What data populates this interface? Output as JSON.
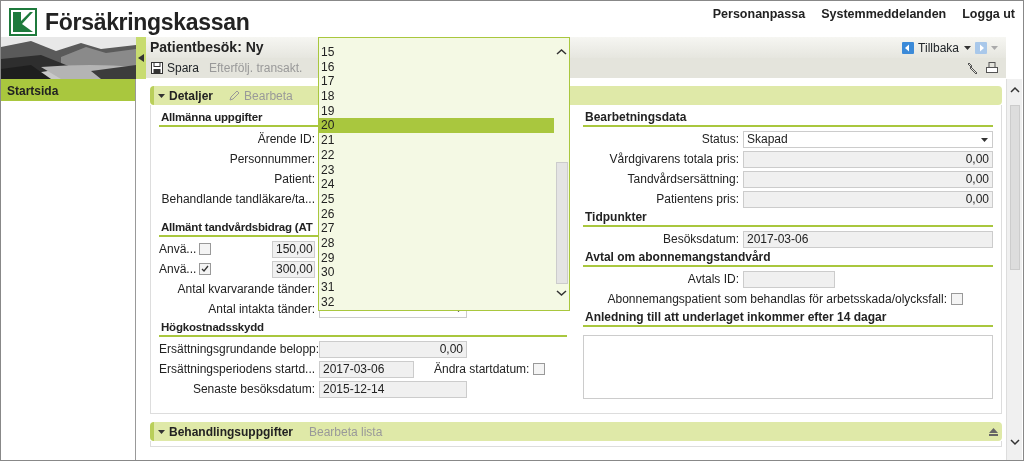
{
  "header": {
    "logo_text": "Försäkringskassan",
    "links": [
      "Personanpassa",
      "Systemmeddelanden",
      "Logga ut"
    ]
  },
  "sidebar": {
    "items": [
      {
        "label": "Startsida",
        "selected": true
      }
    ]
  },
  "page": {
    "title": "Patientbesök: Ny",
    "back_button": "Tillbaka"
  },
  "toolbar": [
    {
      "label": "Spara",
      "disabled": false
    },
    {
      "label": "Efterfölj. transakt.",
      "disabled": true
    }
  ],
  "details": {
    "title": "Detaljer",
    "action": {
      "label": "Bearbeta",
      "disabled": true
    },
    "left": [
      {
        "title": "Allmänna uppgifter",
        "rows": [
          {
            "kind": "label",
            "label": "Ärende ID:"
          },
          {
            "kind": "label",
            "label": "Personnummer:"
          },
          {
            "kind": "label",
            "label": "Patient:"
          },
          {
            "kind": "label",
            "label": "Behandlande tandläkare/ta..."
          }
        ]
      },
      {
        "title": "Allmänt tandvårdsbidrag (AT",
        "rows": [
          {
            "kind": "check_amount",
            "label": "Anvä...",
            "checked": false,
            "value": "150,00"
          },
          {
            "kind": "check_amount",
            "label": "Anvä...",
            "checked": true,
            "value": "300,00"
          },
          {
            "kind": "label",
            "label": "Antal kvarvarande tänder:"
          },
          {
            "kind": "select",
            "label": "Antal intakta tänder:"
          }
        ]
      },
      {
        "title": "Högkostnadsskydd",
        "rows": [
          {
            "kind": "amount",
            "label": "Ersättningsgrundande belopp:",
            "value": "0,00"
          },
          {
            "kind": "date_check",
            "label": "Ersättningsperiodens startd...",
            "value": "2017-03-06",
            "check_label": "Ändra startdatum:",
            "checked": false
          },
          {
            "kind": "date",
            "label": "Senaste besöksdatum:",
            "value": "2015-12-14"
          }
        ]
      }
    ],
    "right": [
      {
        "title": "Bearbetningsdata",
        "rows": [
          {
            "kind": "select",
            "label": "Status:",
            "value": "Skapad"
          },
          {
            "kind": "amount",
            "label": "Vårdgivarens totala pris:",
            "value": "0,00"
          },
          {
            "kind": "amount",
            "label": "Tandvårdsersättning:",
            "value": "0,00"
          },
          {
            "kind": "amount",
            "label": "Patientens pris:",
            "value": "0,00"
          }
        ]
      },
      {
        "title": "Tidpunkter",
        "rows": [
          {
            "kind": "date",
            "label": "Besöksdatum:",
            "value": "2017-03-06"
          }
        ]
      },
      {
        "title": "Avtal om abonnemangstandvård",
        "rows": [
          {
            "kind": "short",
            "label": "Avtals ID:"
          },
          {
            "kind": "checkbox",
            "label": "Abonnemangspatient som behandlas för arbetsskada/olycksfall:",
            "checked": false
          }
        ]
      },
      {
        "title": "Anledning till att underlaget inkommer efter 14 dagar",
        "rows": [
          {
            "kind": "textarea"
          }
        ]
      }
    ]
  },
  "dropdown": {
    "options": [
      {
        "label": "15",
        "selected": false
      },
      {
        "label": "16",
        "selected": false
      },
      {
        "label": "17",
        "selected": false
      },
      {
        "label": "18",
        "selected": false
      },
      {
        "label": "19",
        "selected": false
      },
      {
        "label": "20",
        "selected": true
      },
      {
        "label": "21",
        "selected": false
      },
      {
        "label": "22",
        "selected": false
      },
      {
        "label": "23",
        "selected": false
      },
      {
        "label": "24",
        "selected": false
      },
      {
        "label": "25",
        "selected": false
      },
      {
        "label": "26",
        "selected": false
      },
      {
        "label": "27",
        "selected": false
      },
      {
        "label": "28",
        "selected": false
      },
      {
        "label": "29",
        "selected": false
      },
      {
        "label": "30",
        "selected": false
      },
      {
        "label": "31",
        "selected": false
      },
      {
        "label": "32",
        "selected": false
      }
    ]
  },
  "bottom_panel": {
    "title": "Behandlingsuppgifter",
    "action": {
      "label": "Bearbeta lista",
      "disabled": true
    }
  }
}
